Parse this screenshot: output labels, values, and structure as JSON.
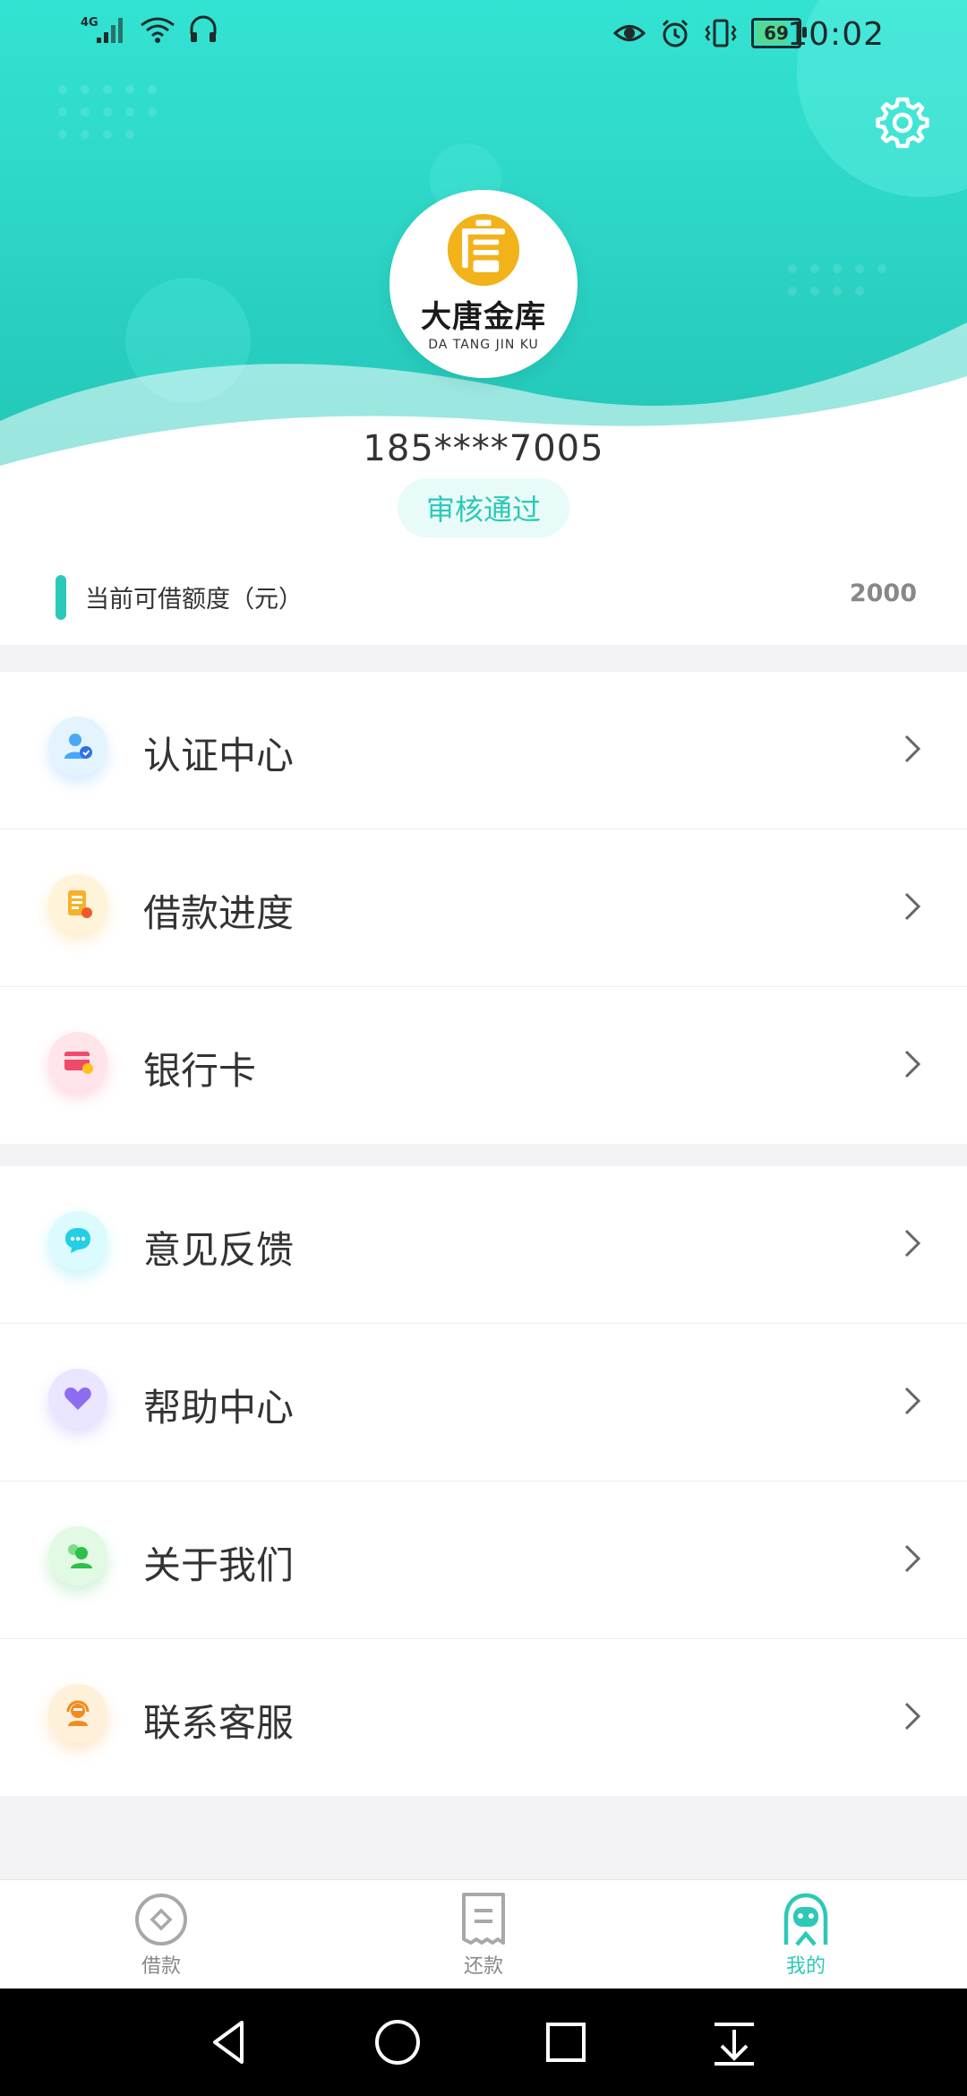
{
  "status": {
    "network": "4G",
    "battery": "69",
    "time": "10:02"
  },
  "profile": {
    "logo_cn": "大唐金库",
    "logo_en": "DA TANG JIN KU",
    "phone": "185****7005",
    "status_badge": "审核通过"
  },
  "limit": {
    "label": "当前可借额度（元）",
    "value": "2000"
  },
  "menu_group_1": [
    {
      "label": "认证中心",
      "icon": "person-check-icon"
    },
    {
      "label": "借款进度",
      "icon": "document-progress-icon"
    },
    {
      "label": "银行卡",
      "icon": "bank-card-icon"
    }
  ],
  "menu_group_2": [
    {
      "label": "意见反馈",
      "icon": "chat-feedback-icon"
    },
    {
      "label": "帮助中心",
      "icon": "heart-help-icon"
    },
    {
      "label": "关于我们",
      "icon": "people-about-icon"
    },
    {
      "label": "联系客服",
      "icon": "headset-service-icon"
    }
  ],
  "tabs": [
    {
      "label": "借款",
      "active": false
    },
    {
      "label": "还款",
      "active": false
    },
    {
      "label": "我的",
      "active": true
    }
  ],
  "colors": {
    "accent": "#2cc9b7",
    "header_top": "#33e3d2",
    "header_bottom": "#22c6b7"
  }
}
